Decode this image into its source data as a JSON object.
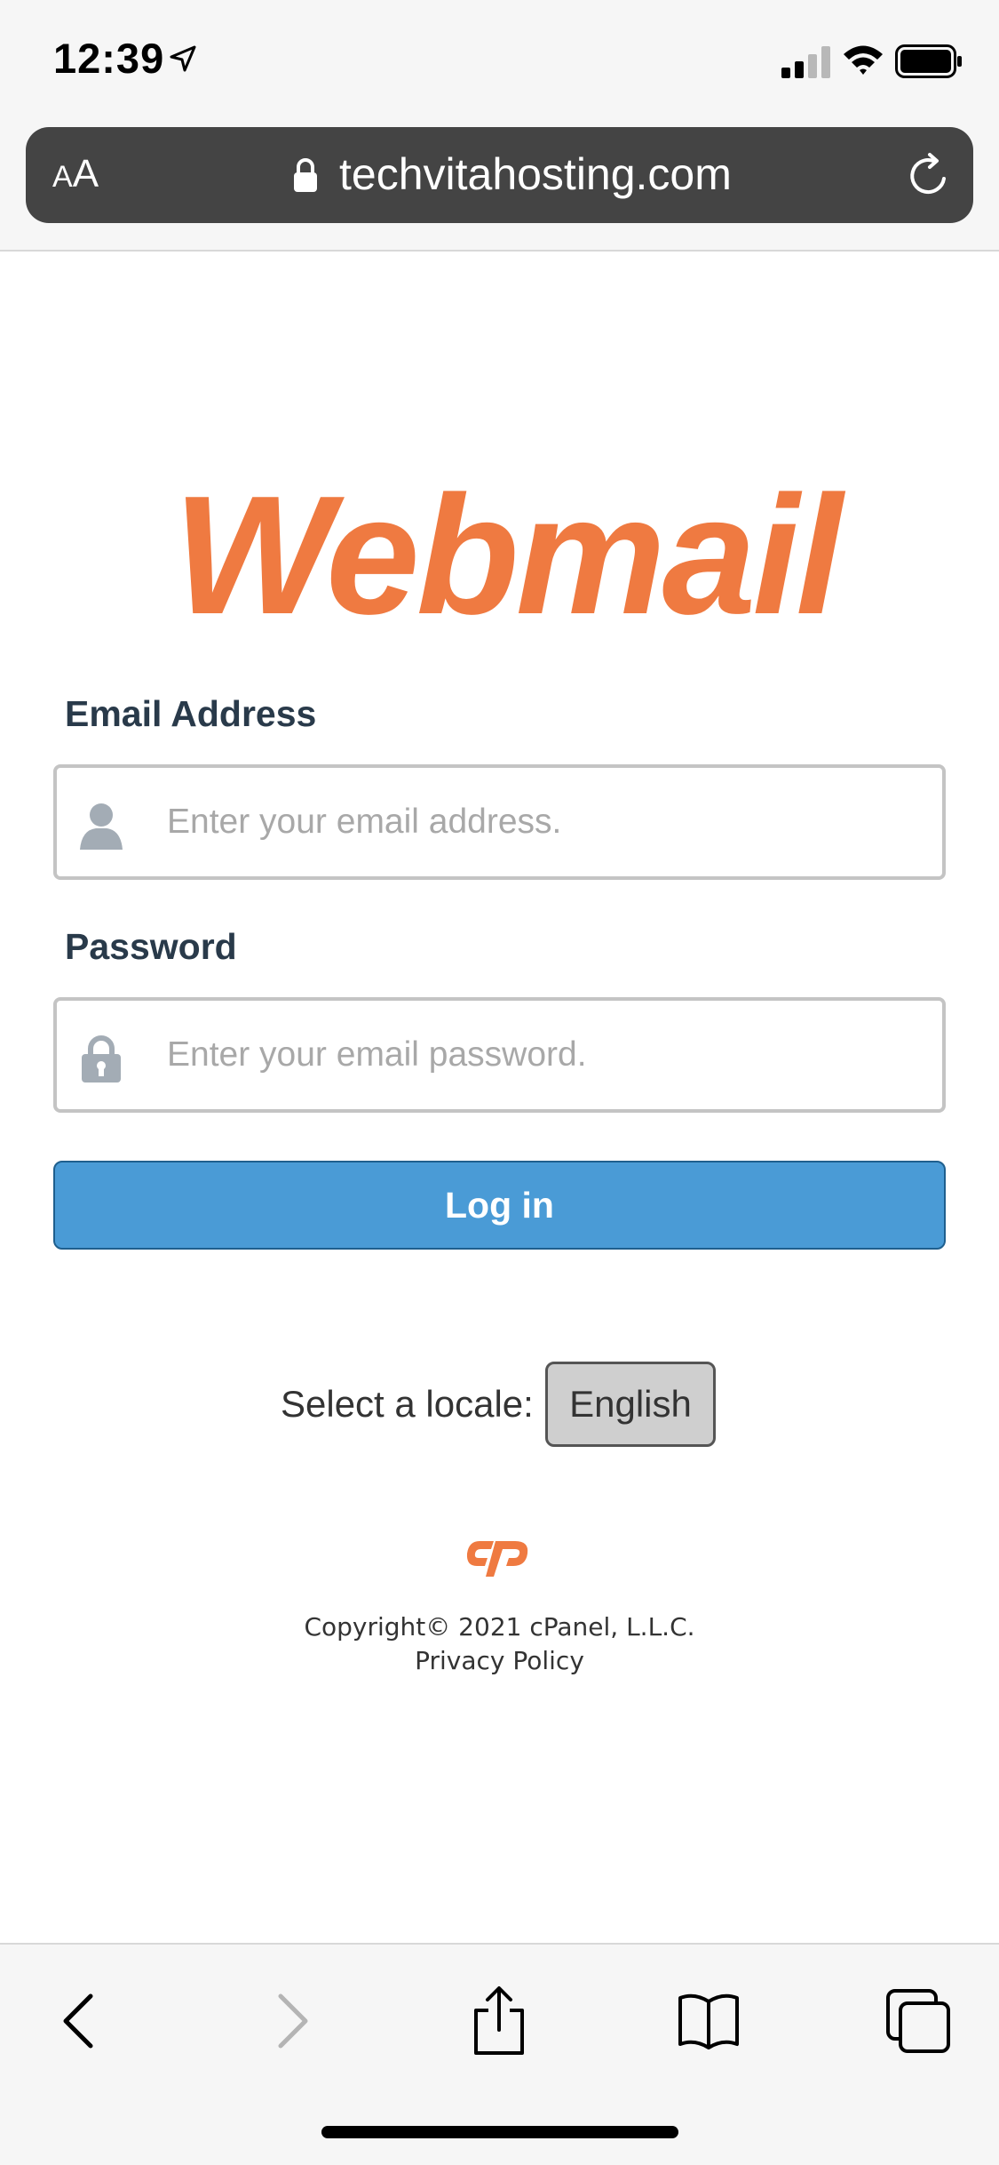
{
  "status_bar": {
    "time": "12:39"
  },
  "browser": {
    "text_size_label_small": "A",
    "text_size_label_large": "A",
    "url": "techvitahosting.com"
  },
  "logo": {
    "text": "Webmail",
    "color": "#ef7a41"
  },
  "form": {
    "email_label": "Email Address",
    "email_placeholder": "Enter your email address.",
    "email_value": "",
    "password_label": "Password",
    "password_placeholder": "Enter your email password.",
    "password_value": "",
    "login_label": "Log in",
    "login_color": "#4a9bd6"
  },
  "locale": {
    "label": "Select a locale:",
    "selected": "English"
  },
  "footer": {
    "copyright": "Copyright© 2021 cPanel, L.L.C.",
    "privacy": "Privacy Policy"
  },
  "icons": {
    "email_field": "user-icon",
    "password_field": "lock-icon",
    "toolbar": [
      "back-icon",
      "forward-icon",
      "share-icon",
      "bookmarks-icon",
      "tabs-icon"
    ]
  }
}
